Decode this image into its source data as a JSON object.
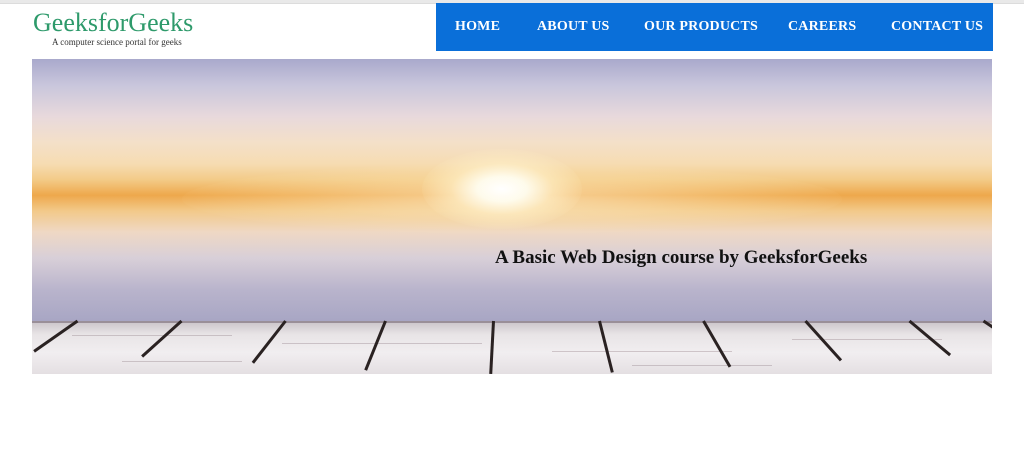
{
  "logo": {
    "title": "GeeksforGeeks",
    "tagline": "A computer science portal for geeks"
  },
  "nav": {
    "items": [
      {
        "label": "HOME"
      },
      {
        "label": "ABOUT US"
      },
      {
        "label": "OUR PRODUCTS"
      },
      {
        "label": "CAREERS"
      },
      {
        "label": "CONTACT US"
      }
    ]
  },
  "hero": {
    "caption": "A Basic Web Design course by GeeksforGeeks"
  },
  "colors": {
    "brand_green": "#2e9a6b",
    "nav_blue": "#0a6fd9",
    "nav_text": "#ffffff"
  }
}
